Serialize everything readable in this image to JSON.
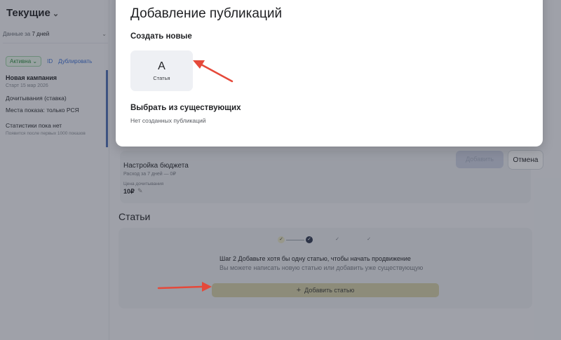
{
  "sidebar": {
    "title": "Текущие",
    "filter_prefix": "Данные за",
    "filter_value": "7 дней",
    "status_badge": "Активна",
    "id_link": "ID",
    "duplicate_link": "Дублировать",
    "campaign": {
      "name": "Новая кампания",
      "start": "Старт 15 мар 2026",
      "type": "Дочитывания (ставка)",
      "places": "Места показа: только РСЯ",
      "stats": "Статистики пока нет",
      "stats_hint": "Появится после первых 1000 показов"
    }
  },
  "budget": {
    "title": "Настройка бюджета",
    "subtitle": "Расход за 7 дней — 0₽",
    "price_label": "Цена дочитывания",
    "price_value": "10₽"
  },
  "actions": {
    "add_label": "Добавить",
    "cancel_label": "Отмена"
  },
  "articles": {
    "section_title": "Статьи",
    "step_hint_title": "Шаг 2 Добавьте хотя бы одну статью, чтобы начать продвижение",
    "step_hint_text": "Вы можете написать новую статью или добавить уже существующую",
    "add_button": "Добавить статью"
  },
  "modal": {
    "title": "Добавление публикаций",
    "create_new": "Создать новые",
    "tile_letter": "A",
    "tile_label": "Статья",
    "choose_existing": "Выбрать из существующих",
    "empty_text": "Нет созданных публикаций"
  },
  "colors": {
    "annotation_arrow": "#e5493a",
    "add_article_button": "#d6d1a8",
    "active_badge": "#2b8a3e"
  }
}
